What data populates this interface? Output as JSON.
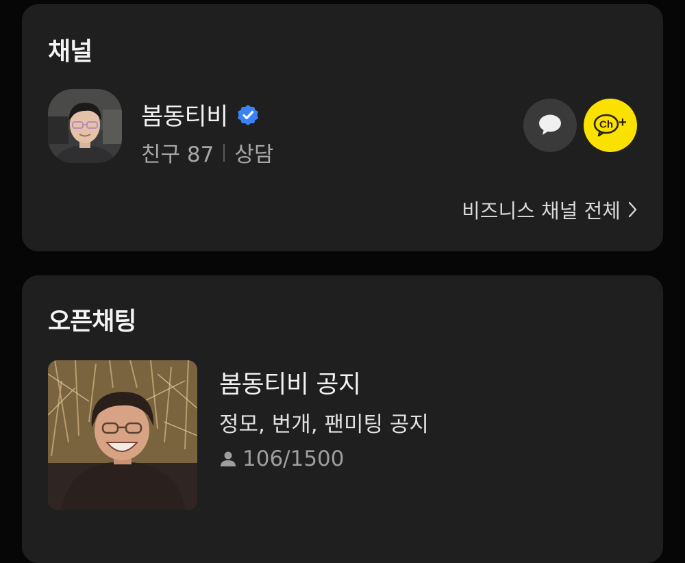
{
  "channel_section": {
    "title": "채널",
    "channel": {
      "name": "봄동티비",
      "verified": true,
      "friends_label": "친구 87",
      "consult_label": "상담"
    },
    "buttons": {
      "chat_icon": "chat-bubble-icon",
      "add_channel_icon": "channel-plus-icon",
      "add_channel_text": "Ch",
      "add_channel_plus": "+"
    },
    "all_link": "비즈니스 채널 전체"
  },
  "openchat_section": {
    "title": "오픈채팅",
    "room": {
      "title": "봄동티비 공지",
      "description": "정모, 번개, 팬미팅 공지",
      "members": "106/1500"
    }
  },
  "colors": {
    "background": "#060606",
    "card": "#1f1f1f",
    "channel_accent": "#fae100",
    "verified": "#3b82f6"
  }
}
